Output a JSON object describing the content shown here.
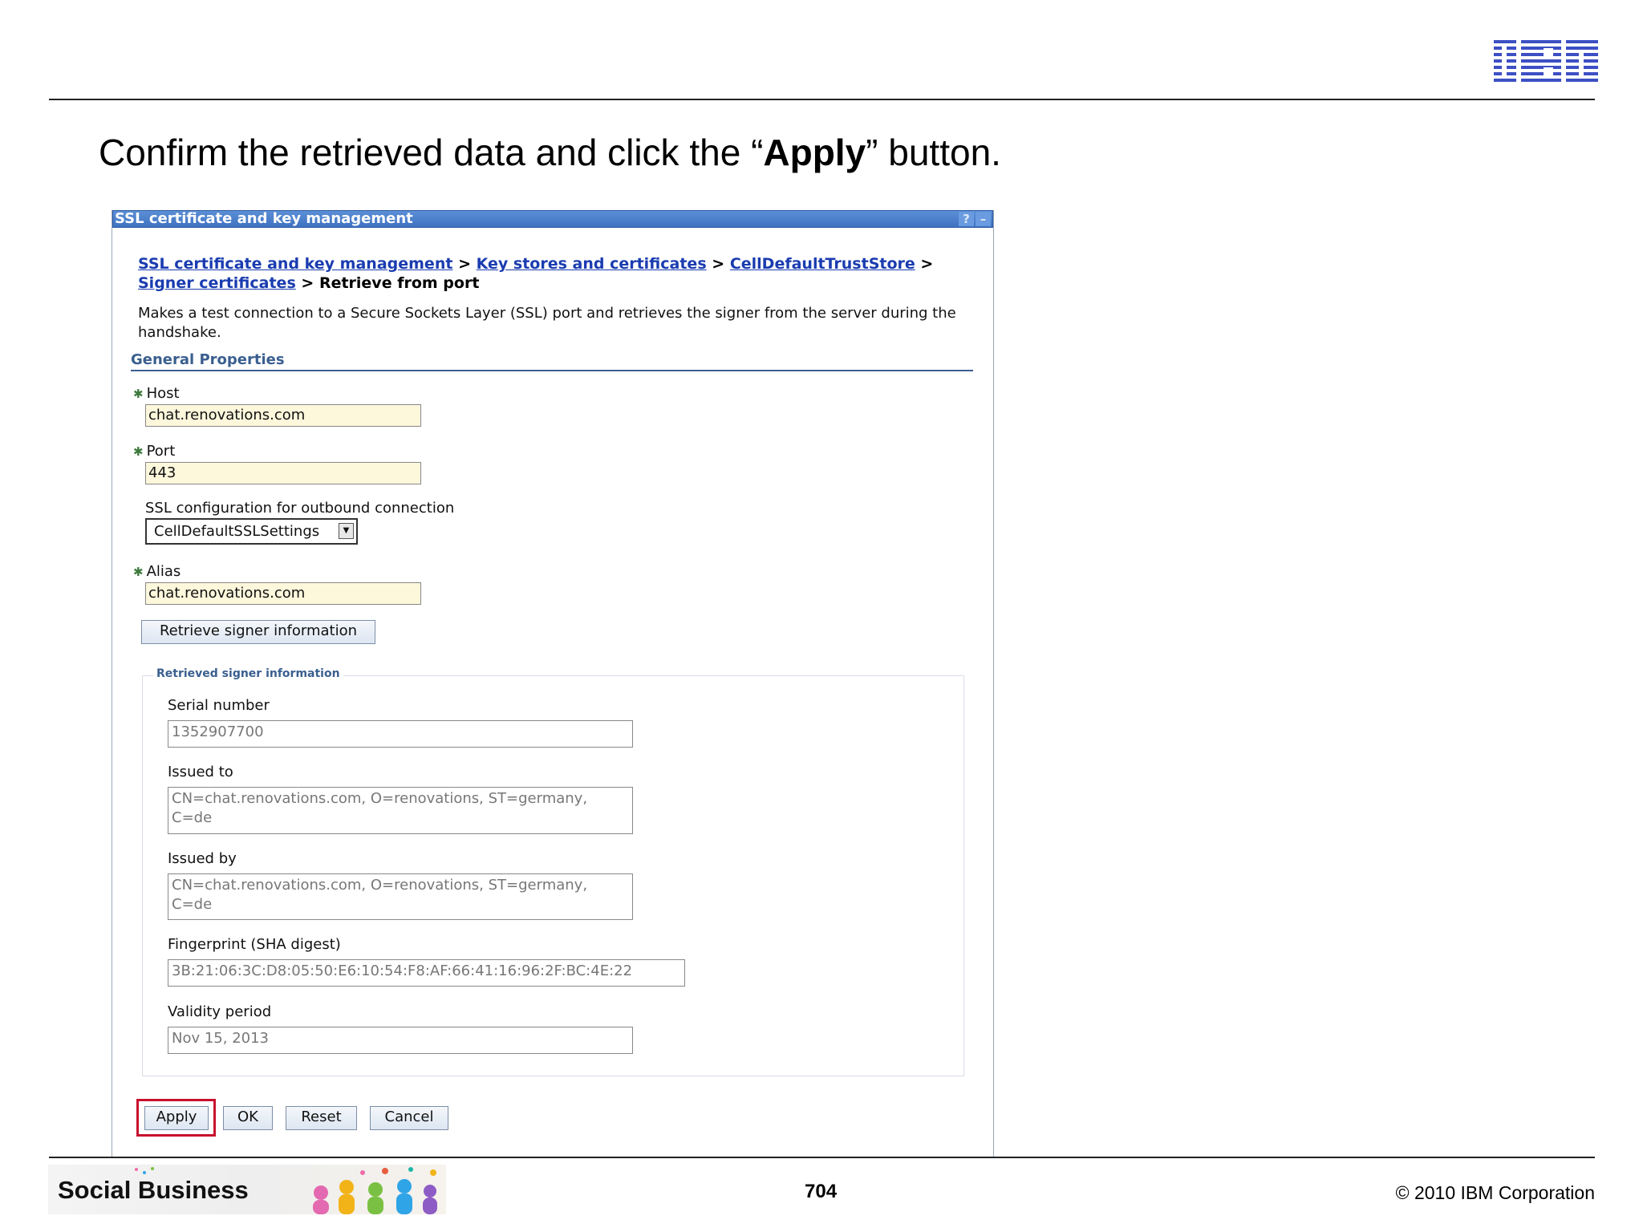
{
  "slide": {
    "instruction_before": "Confirm the retrieved data and click the “",
    "instruction_bold": "Apply",
    "instruction_after": "” button.",
    "brand": "IBM",
    "footer_brand": "Social Business",
    "page_number": "704",
    "copyright": "© 2010 IBM Corporation"
  },
  "window": {
    "title": "SSL certificate and key management",
    "help_label": "?",
    "minimize_label": "–"
  },
  "breadcrumb": {
    "items": [
      "SSL certificate and key management",
      "Key stores and certificates",
      "CellDefaultTrustStore",
      "Signer certificates"
    ],
    "separator": ">",
    "current": "Retrieve from port"
  },
  "description": "Makes a test connection to a Secure Sockets Layer (SSL) port and retrieves the signer from the server during the handshake.",
  "general_properties": {
    "title": "General Properties",
    "host": {
      "label": "Host",
      "value": "chat.renovations.com"
    },
    "port": {
      "label": "Port",
      "value": "443"
    },
    "ssl_config": {
      "label": "SSL configuration for outbound connection",
      "value": "CellDefaultSSLSettings"
    },
    "alias": {
      "label": "Alias",
      "value": "chat.renovations.com"
    },
    "retrieve_button": "Retrieve signer information",
    "required_marker": "✱"
  },
  "retrieved": {
    "legend": "Retrieved signer information",
    "serial": {
      "label": "Serial number",
      "value": "1352907700"
    },
    "issued_to": {
      "label": "Issued to",
      "value": "CN=chat.renovations.com, O=renovations, ST=germany,\nC=de"
    },
    "issued_by": {
      "label": "Issued by",
      "value": "CN=chat.renovations.com, O=renovations, ST=germany,\nC=de"
    },
    "fingerprint": {
      "label": "Fingerprint (SHA digest)",
      "value": "3B:21:06:3C:D8:05:50:E6:10:54:F8:AF:66:41:16:96:2F:BC:4E:22"
    },
    "validity": {
      "label": "Validity period",
      "value": "Nov 15, 2013"
    }
  },
  "actions": {
    "apply": "Apply",
    "ok": "OK",
    "reset": "Reset",
    "cancel": "Cancel"
  },
  "colors": {
    "highlight": "#c8102e",
    "link": "#1a3cb0",
    "titlebar": "#3f72c2",
    "section": "#3a5f8f"
  }
}
